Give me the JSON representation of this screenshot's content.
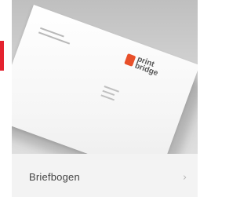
{
  "theme": {
    "accent": "#e4232f",
    "logo_color": "#e8502a"
  },
  "card": {
    "title": "Briefbogen",
    "chevron_icon": "chevron-right-icon",
    "image_logo_text": "print\nbridge"
  }
}
